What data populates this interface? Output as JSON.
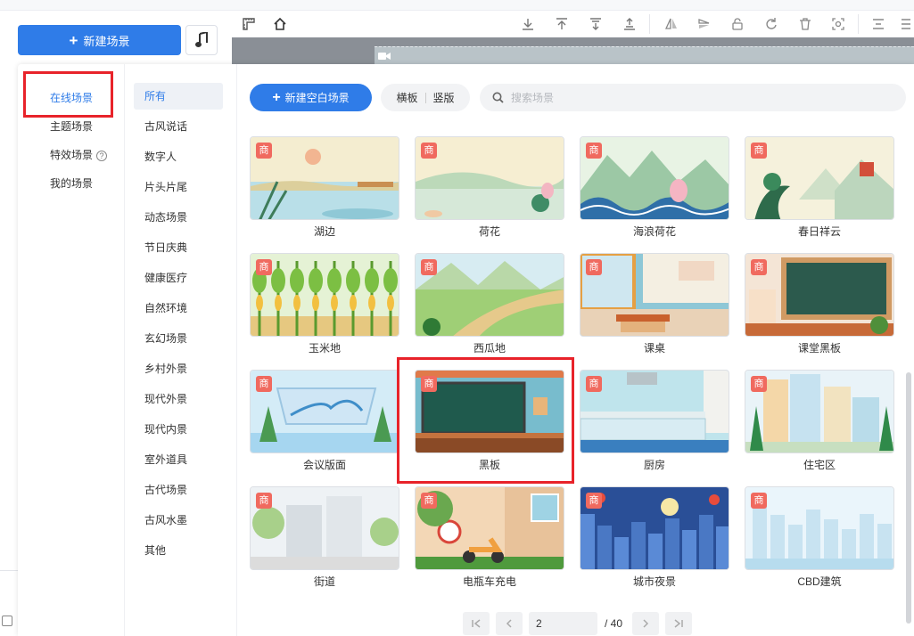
{
  "header": {
    "new_scene_label": "新建场景",
    "music_icon": "music-note-icon"
  },
  "categories_primary": [
    {
      "label": "在线场景",
      "active": true
    },
    {
      "label": "主题场景"
    },
    {
      "label": "特效场景",
      "help": "?"
    },
    {
      "label": "我的场景"
    }
  ],
  "categories_secondary": [
    {
      "label": "所有",
      "active": true
    },
    {
      "label": "古风说话"
    },
    {
      "label": "数字人"
    },
    {
      "label": "片头片尾"
    },
    {
      "label": "动态场景"
    },
    {
      "label": "节日庆典"
    },
    {
      "label": "健康医疗"
    },
    {
      "label": "自然环境"
    },
    {
      "label": "玄幻场景"
    },
    {
      "label": "乡村外景"
    },
    {
      "label": "现代外景"
    },
    {
      "label": "现代内景"
    },
    {
      "label": "室外道具"
    },
    {
      "label": "古代场景"
    },
    {
      "label": "古风水墨"
    },
    {
      "label": "其他"
    }
  ],
  "toolbar_row": {
    "new_blank_label": "新建空白场景",
    "landscape_label": "横板",
    "portrait_label": "竖版",
    "search_placeholder": "搜索场景"
  },
  "badge_text": "商",
  "scenes": [
    {
      "label": "湖边",
      "theme": "lake"
    },
    {
      "label": "荷花",
      "theme": "lotus"
    },
    {
      "label": "海浪荷花",
      "theme": "wave-lotus"
    },
    {
      "label": "春日祥云",
      "theme": "spring-cloud"
    },
    {
      "label": "玉米地",
      "theme": "corn"
    },
    {
      "label": "西瓜地",
      "theme": "watermelon"
    },
    {
      "label": "课桌",
      "theme": "desk"
    },
    {
      "label": "课堂黑板",
      "theme": "class-board"
    },
    {
      "label": "会议版面",
      "theme": "meeting"
    },
    {
      "label": "黑板",
      "theme": "blackboard"
    },
    {
      "label": "厨房",
      "theme": "kitchen"
    },
    {
      "label": "住宅区",
      "theme": "residential"
    },
    {
      "label": "街道",
      "theme": "street"
    },
    {
      "label": "电瓶车充电",
      "theme": "ebike"
    },
    {
      "label": "城市夜景",
      "theme": "night-city"
    },
    {
      "label": "CBD建筑",
      "theme": "cbd"
    }
  ],
  "pagination": {
    "current": "2",
    "total": "/ 40"
  },
  "colors": {
    "accent": "#2f7ce8",
    "badge": "#f06a5f",
    "highlight": "#e8232a"
  }
}
